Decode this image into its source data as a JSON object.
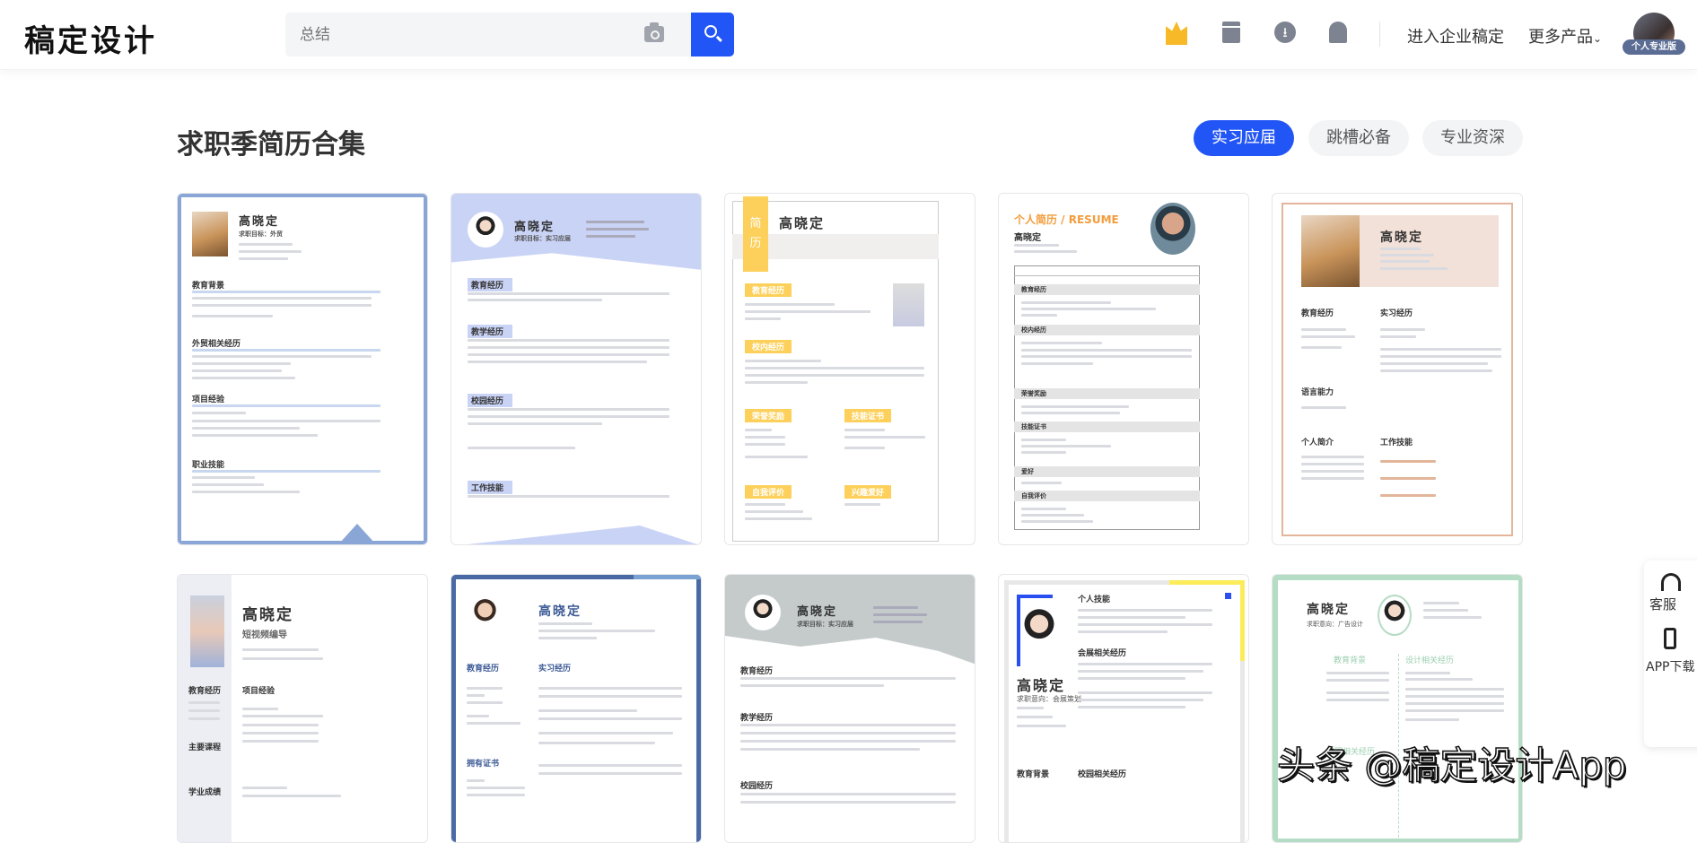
{
  "header": {
    "logo": "稿定设计",
    "search_placeholder": "总结",
    "enterprise_link": "进入企业稿定",
    "more_products": "更多产品",
    "more_chevron": "⌄",
    "badge": "个人专业版",
    "download_glyph": "⭳"
  },
  "page": {
    "title": "求职季简历合集",
    "tabs": [
      {
        "label": "实习应届",
        "active": true
      },
      {
        "label": "跳槽必备",
        "active": false
      },
      {
        "label": "专业资深",
        "active": false
      }
    ]
  },
  "cards": [
    {
      "name": "高晓定",
      "subtitle": "求职目标：外贸",
      "sections": [
        "教育背景",
        "外贸相关经历",
        "项目经验",
        "职业技能"
      ],
      "accent": "#8aa6d6"
    },
    {
      "name": "高晓定",
      "subtitle": "求职目标：实习应届",
      "sections": [
        "教育经历",
        "教学经历",
        "校园经历",
        "工作技能"
      ],
      "accent": "#c9d3f5"
    },
    {
      "name": "高晓定",
      "stripe": [
        "简",
        "历"
      ],
      "sections": [
        "教育经历",
        "校内经历",
        "荣誉奖励",
        "技能证书",
        "自我评价",
        "兴趣爱好"
      ],
      "accent": "#fcd05a"
    },
    {
      "heading": "个人简历 / RESUME",
      "name": "高晓定",
      "sections": [
        "教育经历",
        "校内经历",
        "荣誉奖励",
        "技能证书",
        "爱好",
        "自我评价"
      ],
      "accent": "#f39c3c"
    },
    {
      "name": "高晓定",
      "sections": [
        "教育经历",
        "实习经历",
        "语言能力",
        "个人简介",
        "工作技能"
      ],
      "accent": "#e3b59a"
    },
    {
      "name": "高晓定",
      "subtitle": "短视频编导",
      "sections": [
        "教育经历",
        "主要课程",
        "学业成绩",
        "项目经验"
      ],
      "accent": "#eceef3"
    },
    {
      "name": "高晓定",
      "sections": [
        "教育经历",
        "实习经历",
        "拥有证书"
      ],
      "accent": "#4a6aa5"
    },
    {
      "name": "高晓定",
      "subtitle": "求职目标：实习应届",
      "sections": [
        "教育经历",
        "教学经历",
        "校园经历"
      ],
      "accent": "#c5cbcb"
    },
    {
      "name": "高晓定",
      "subtitle": "求职意向：会展策划",
      "sections": [
        "个人技能",
        "会展相关经历",
        "教育背景",
        "校园相关经历"
      ],
      "accent": "#2a4ff0"
    },
    {
      "name": "高晓定",
      "subtitle": "求职意向：广告设计",
      "sections": [
        "教育背景",
        "设计相关经历",
        "校园相关经历"
      ],
      "accent": "#b5dcc4"
    }
  ],
  "side_panel": {
    "service": "客服",
    "app_download": "APP下载"
  },
  "watermark": "头条 @稿定设计App"
}
